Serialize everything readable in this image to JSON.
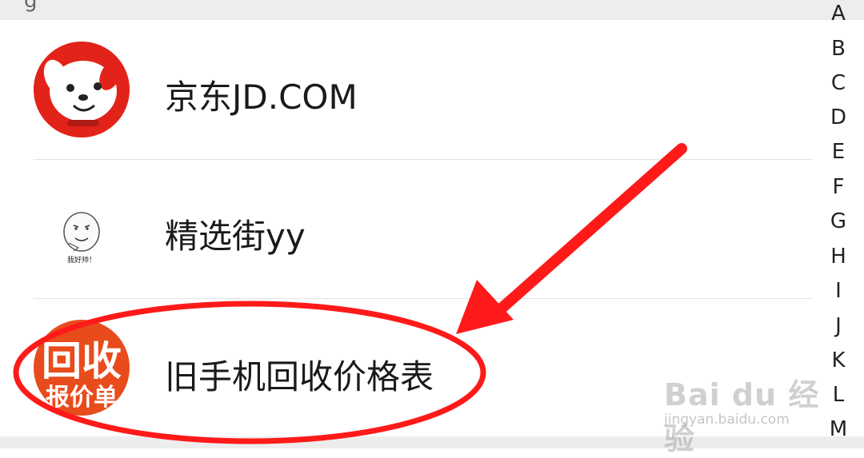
{
  "contacts": [
    {
      "name": "京东JD.COM",
      "avatar": "jd-dog-avatar-icon"
    },
    {
      "name": "精选街yy",
      "avatar": "meme-face-avatar-icon",
      "avatar_caption": "我好帅！"
    },
    {
      "name": "旧手机回收价格表",
      "avatar": "recycle-price-avatar-icon",
      "avatar_text_line1": "回收",
      "avatar_text_line2": "报价单"
    }
  ],
  "index_letters": [
    "A",
    "B",
    "C",
    "D",
    "E",
    "F",
    "G",
    "H",
    "I",
    "J",
    "K",
    "L",
    "M"
  ],
  "watermark": {
    "main": "Bai du 经验",
    "sub": "jingyan.baidu.com"
  },
  "colors": {
    "annotation_red": "#ff1a1a",
    "jd_red": "#e2231a",
    "recycle_orange": "#e84c1c"
  }
}
